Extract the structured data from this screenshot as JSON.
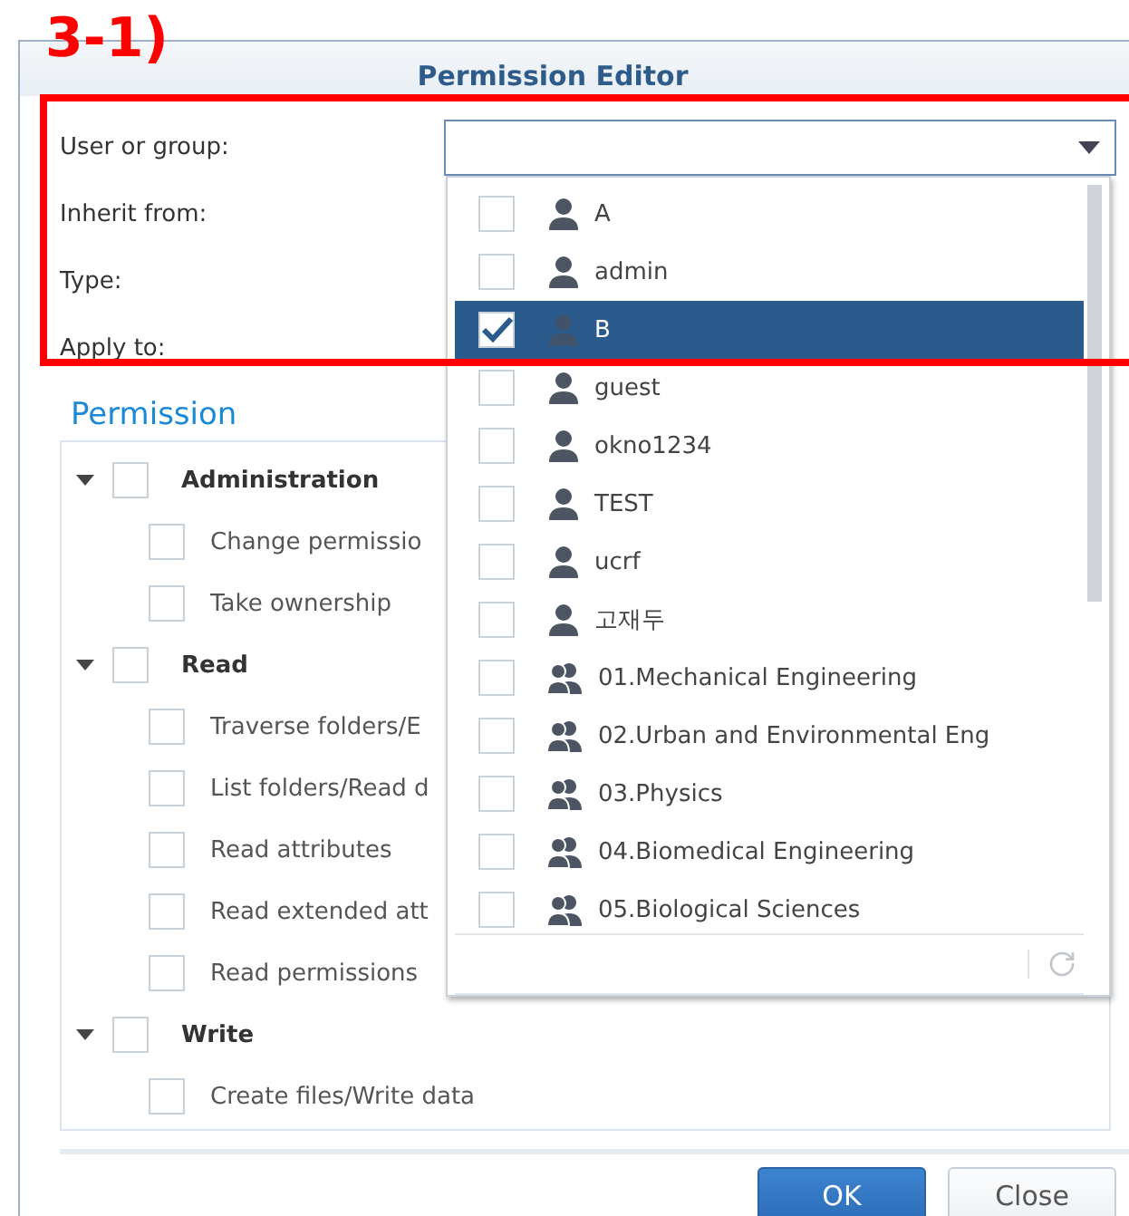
{
  "annotation": {
    "label": "3-1)"
  },
  "dialog": {
    "title": "Permission Editor"
  },
  "form": {
    "fields": [
      {
        "label": "User or group:",
        "kind": "dropdown",
        "expanded": true
      },
      {
        "label": "Inherit from:",
        "kind": "plain"
      },
      {
        "label": "Type:",
        "kind": "plain"
      },
      {
        "label": "Apply to:",
        "kind": "plain"
      }
    ]
  },
  "dropdown_options": [
    {
      "name": "A",
      "kind": "user",
      "checked": false,
      "selected": false
    },
    {
      "name": "admin",
      "kind": "user",
      "checked": false,
      "selected": false
    },
    {
      "name": "B",
      "kind": "user",
      "checked": true,
      "selected": true
    },
    {
      "name": "guest",
      "kind": "user",
      "checked": false,
      "selected": false
    },
    {
      "name": "okno1234",
      "kind": "user",
      "checked": false,
      "selected": false
    },
    {
      "name": "TEST",
      "kind": "user",
      "checked": false,
      "selected": false
    },
    {
      "name": "ucrf",
      "kind": "user",
      "checked": false,
      "selected": false
    },
    {
      "name": "고재두",
      "kind": "user",
      "checked": false,
      "selected": false
    },
    {
      "name": "01.Mechanical Engineering",
      "kind": "group",
      "checked": false,
      "selected": false
    },
    {
      "name": "02.Urban and Environmental Eng",
      "kind": "group",
      "checked": false,
      "selected": false
    },
    {
      "name": "03.Physics",
      "kind": "group",
      "checked": false,
      "selected": false
    },
    {
      "name": "04.Biomedical Engineering",
      "kind": "group",
      "checked": false,
      "selected": false
    },
    {
      "name": "05.Biological Sciences",
      "kind": "group",
      "checked": false,
      "selected": false
    }
  ],
  "permission": {
    "title": "Permission",
    "tree": [
      {
        "label": "Administration",
        "expanded": true,
        "checked": false,
        "children": [
          {
            "label": "Change permissio",
            "checked": false
          },
          {
            "label": "Take ownership",
            "checked": false
          }
        ]
      },
      {
        "label": "Read",
        "expanded": true,
        "checked": false,
        "children": [
          {
            "label": "Traverse folders/E",
            "checked": false
          },
          {
            "label": "List folders/Read d",
            "checked": false
          },
          {
            "label": "Read attributes",
            "checked": false
          },
          {
            "label": "Read extended att",
            "checked": false
          },
          {
            "label": "Read permissions",
            "checked": false
          }
        ]
      },
      {
        "label": "Write",
        "expanded": true,
        "checked": false,
        "children": [
          {
            "label": "Create files/Write data",
            "checked": false
          }
        ]
      }
    ]
  },
  "buttons": [
    {
      "label": "OK",
      "kind": "primary"
    },
    {
      "label": "Close",
      "kind": "secondary"
    }
  ]
}
